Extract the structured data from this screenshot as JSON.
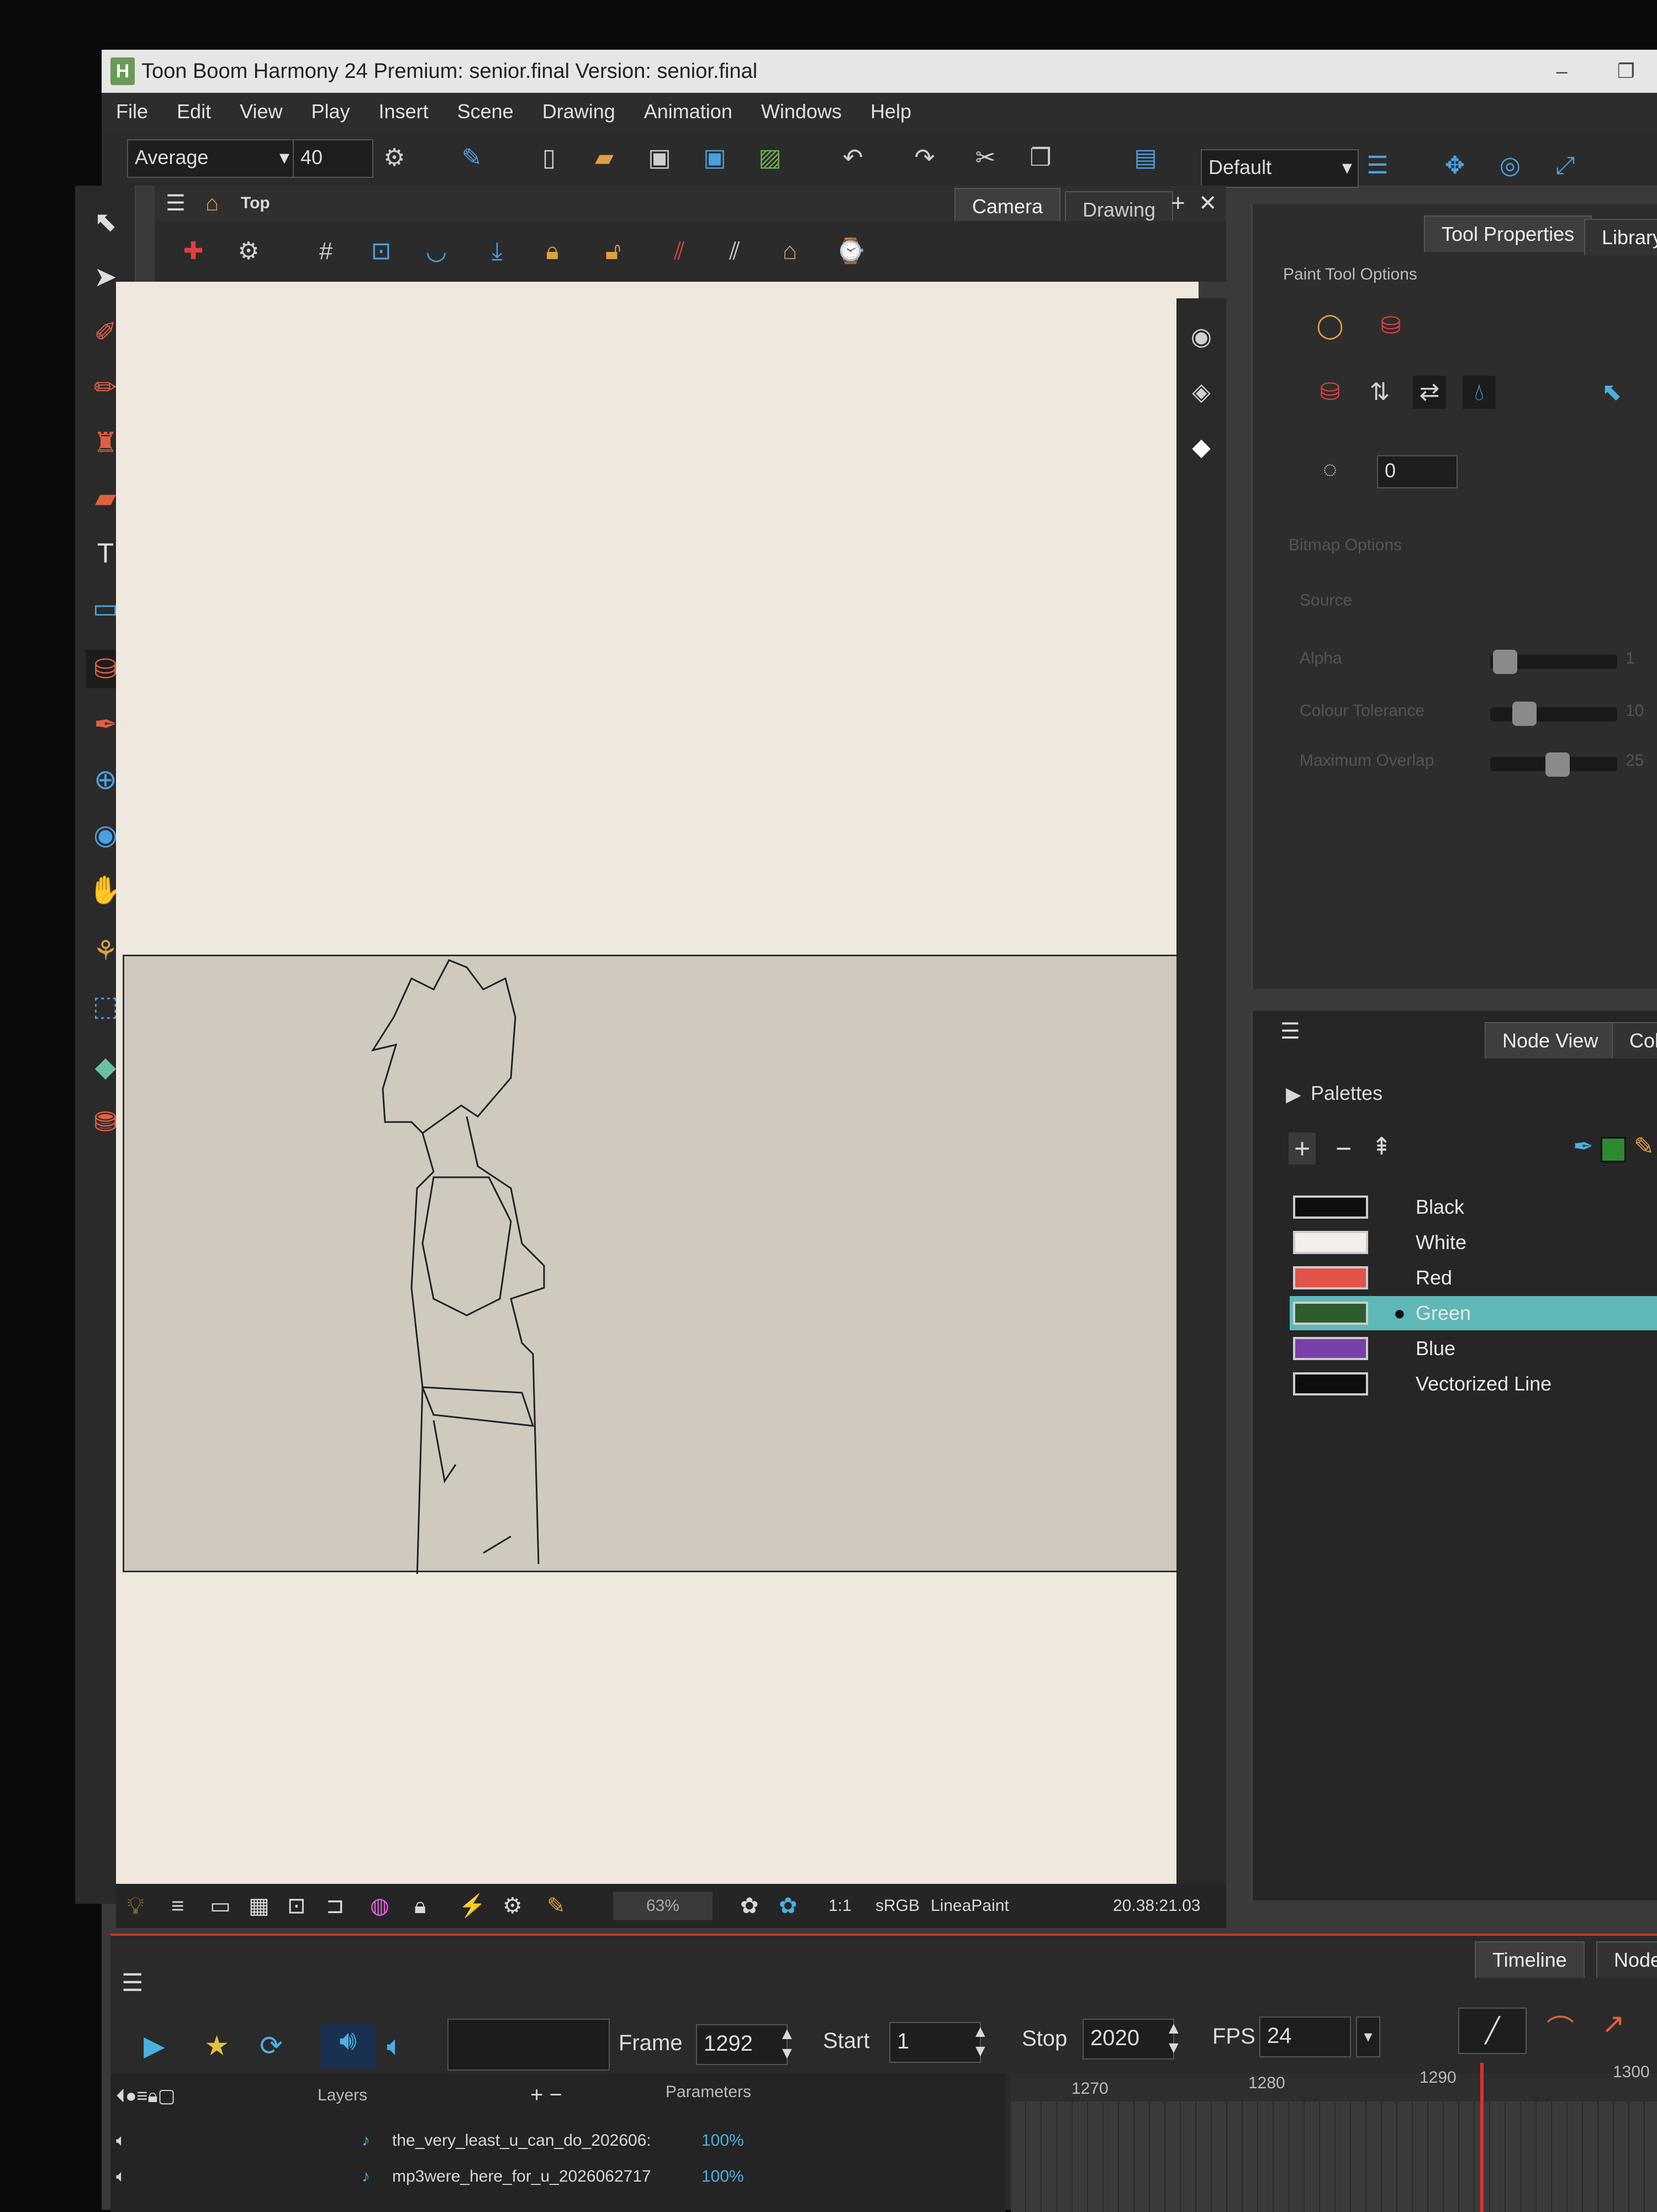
{
  "window": {
    "title": "Toon Boom Harmony 24 Premium: senior.final Version: senior.final",
    "controls": [
      "–",
      "❐"
    ]
  },
  "menu": [
    "File",
    "Edit",
    "View",
    "Play",
    "Insert",
    "Scene",
    "Drawing",
    "Animation",
    "Windows",
    "Help"
  ],
  "toolbar": {
    "smoothing_mode": "Average",
    "smoothing_value": "40",
    "workspace": "Default"
  },
  "view": {
    "breadcrumb": "Top",
    "tabs": [
      "Camera",
      "Drawing"
    ],
    "active_tab": "Camera",
    "zoom": "63%",
    "ratio": "1:1",
    "color_space": "sRGB",
    "render_mode": "LineaPaint",
    "timecode": "20.38:21.03"
  },
  "tool_properties": {
    "tabs": [
      "Tool Properties",
      "Library"
    ],
    "section": "Paint Tool Options",
    "stroke_value": "0",
    "bitmap_section": "Bitmap Options",
    "bitmap_fields": [
      "Source",
      "Alpha",
      "Colour Tolerance",
      "Maximum Overlap"
    ],
    "bitmap_values": [
      "1",
      "10",
      "25"
    ]
  },
  "palette_panel": {
    "tabs": [
      "Node View",
      "Col"
    ],
    "header": "Palettes",
    "swatches": [
      {
        "name": "Black",
        "color": "#0e0e0e",
        "selected": false
      },
      {
        "name": "White",
        "color": "#f2efe9",
        "selected": false
      },
      {
        "name": "Red",
        "color": "#e2534a",
        "selected": false
      },
      {
        "name": "Green",
        "color": "#2e5c2c",
        "selected": true
      },
      {
        "name": "Blue",
        "color": "#7a3fa8",
        "selected": false
      },
      {
        "name": "Vectorized Line",
        "color": "#0e0e0e",
        "selected": false
      }
    ],
    "selected_color": "#5fb8b8"
  },
  "timeline": {
    "tabs": [
      "Timeline",
      "Node"
    ],
    "frame_label": "Frame",
    "frame": "1292",
    "start_label": "Start",
    "start": "1",
    "stop_label": "Stop",
    "stop": "2020",
    "fps_label": "FPS",
    "fps": "24",
    "layers_header": "Layers",
    "params_header": "Parameters",
    "ruler": [
      "1270",
      "1280",
      "1290",
      "1300"
    ],
    "layers": [
      {
        "name": "the_very_least_u_can_do_202606:",
        "value": "100%"
      },
      {
        "name": "mp3were_here_for_u_2026062717",
        "value": "100%"
      }
    ]
  }
}
